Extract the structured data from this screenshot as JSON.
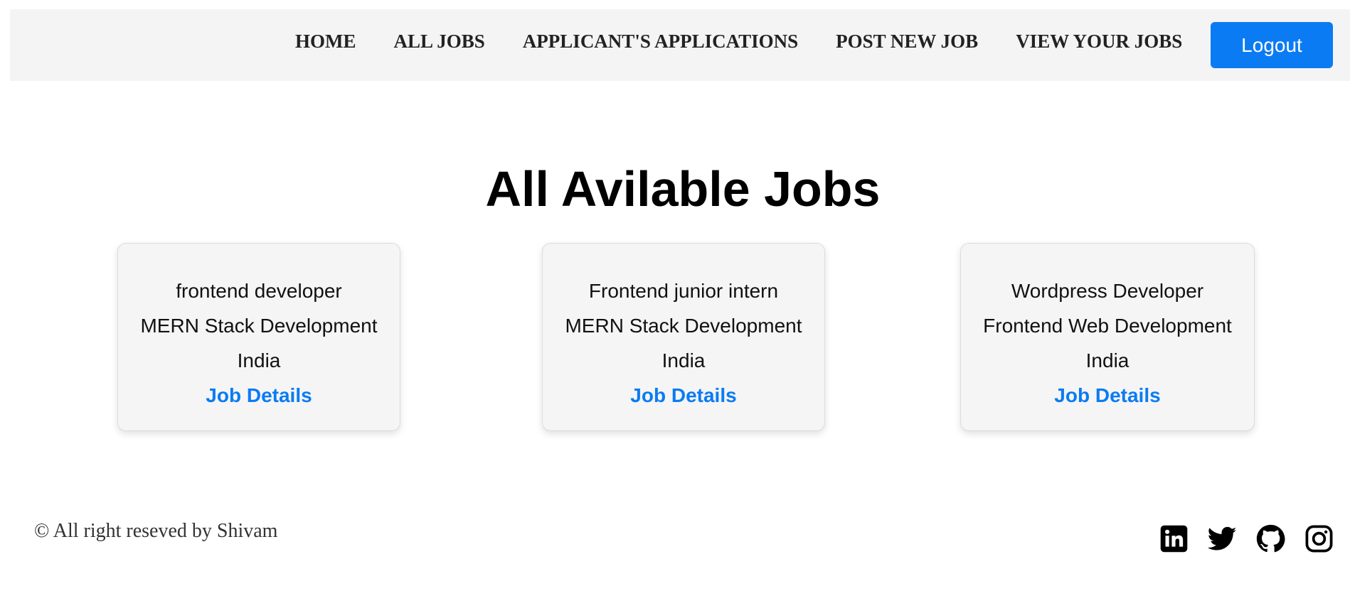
{
  "navbar": {
    "links": [
      {
        "label": "HOME"
      },
      {
        "label": "ALL JOBS"
      },
      {
        "label": "APPLICANT'S APPLICATIONS"
      },
      {
        "label": "POST NEW JOB"
      },
      {
        "label": "VIEW YOUR JOBS"
      }
    ],
    "logout_label": "Logout"
  },
  "main": {
    "title": "All Avilable Jobs",
    "jobs": [
      {
        "title": "frontend developer",
        "category": "MERN Stack Development",
        "location": "India",
        "link_label": "Job Details"
      },
      {
        "title": "Frontend junior intern",
        "category": "MERN Stack Development",
        "location": "India",
        "link_label": "Job Details"
      },
      {
        "title": "Wordpress Developer",
        "category": "Frontend Web Development",
        "location": "India",
        "link_label": "Job Details"
      }
    ]
  },
  "footer": {
    "copyright": "© All right reseved by Shivam",
    "social_icons": [
      "linkedin-icon",
      "twitter-icon",
      "github-icon",
      "instagram-icon"
    ]
  },
  "colors": {
    "accent": "#0b7bf3",
    "navbar_bg": "#f4f4f4",
    "card_bg": "#f5f5f5"
  }
}
